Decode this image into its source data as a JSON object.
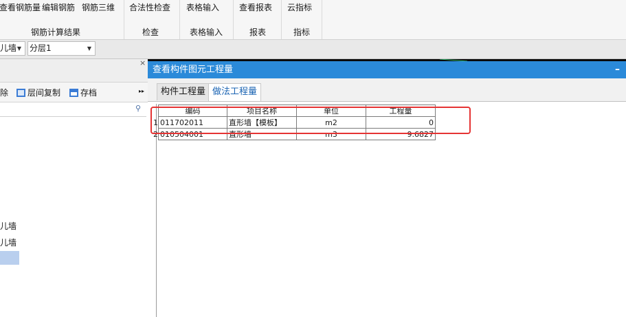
{
  "ribbon": {
    "buttons": [
      "查看钢筋量",
      "编辑钢筋",
      "钢筋三维",
      "合法性检查",
      "表格输入",
      "查看报表",
      "云指标"
    ],
    "groups": [
      "钢筋计算结果",
      "检查",
      "表格输入",
      "报表",
      "指标"
    ]
  },
  "selectors": {
    "type": "儿墙",
    "layer": "分层1"
  },
  "left_panel": {
    "close": "×",
    "tools": {
      "delete": "除",
      "copy": "层间复制",
      "save": "存档",
      "more": "▸▸"
    },
    "items": [
      "儿墙",
      "儿墙"
    ]
  },
  "dialog": {
    "title": "查看构件图元工程量",
    "minimize": "–",
    "tabs": [
      "构件工程量",
      "做法工程量"
    ],
    "active_tab": "做法工程量",
    "table": {
      "headers": [
        "编码",
        "项目名称",
        "单位",
        "工程量"
      ],
      "rows": [
        {
          "num": "1",
          "code": "011702011",
          "name": "直形墙【模板】",
          "unit": "m2",
          "qty": "0"
        },
        {
          "num": "2",
          "code": "010504001",
          "name": "直形墙",
          "unit": "m3",
          "qty": "9.6827"
        }
      ]
    }
  },
  "colors": {
    "title_bar": "#2b8ad9",
    "highlight_box": "#e53333",
    "tree_selection": "#b9cfee",
    "active_tab_text": "#1b64b3"
  }
}
